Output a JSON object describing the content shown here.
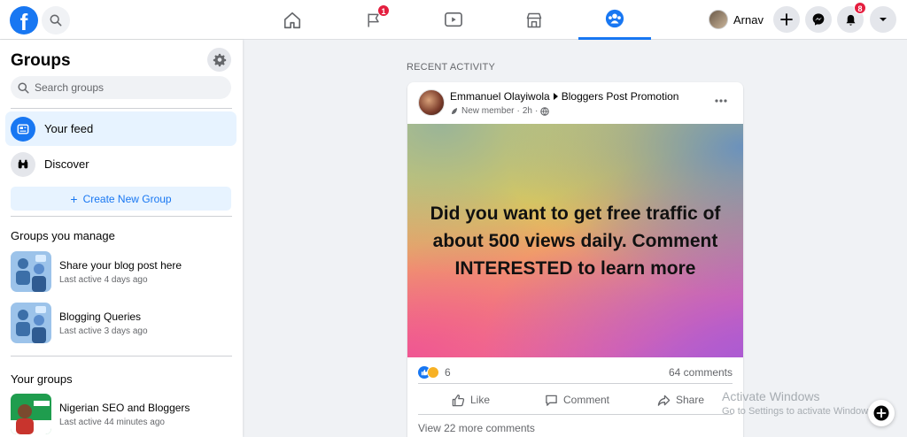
{
  "topbar": {
    "logo_letter": "f",
    "notifications_badge": "1",
    "alerts_badge": "8",
    "profile_name": "Arnav",
    "accent_color": "#1877f2"
  },
  "sidebar": {
    "title": "Groups",
    "search_placeholder": "Search groups",
    "items": [
      {
        "label": "Your feed",
        "icon": "feed-icon",
        "active": true
      },
      {
        "label": "Discover",
        "icon": "binoculars-icon",
        "active": false
      }
    ],
    "create_label": "Create New Group",
    "manage_title": "Groups you manage",
    "managed_groups": [
      {
        "name": "Share your blog post here",
        "last_active": "Last active 4 days ago"
      },
      {
        "name": "Blogging Queries",
        "last_active": "Last active 3 days ago"
      }
    ],
    "your_groups_title": "Your groups",
    "your_groups": [
      {
        "name": "Nigerian SEO and Bloggers",
        "last_active": "Last active 44 minutes ago"
      }
    ]
  },
  "feed": {
    "section_label": "RECENT ACTIVITY",
    "post": {
      "author": "Emmanuel Olayiwola",
      "group": "Bloggers Post Promotion",
      "role": "New member",
      "time": "2h",
      "text": "Did you want to get free traffic of about 500 views daily. Comment INTERESTED to learn more",
      "reaction_count": "6",
      "comments_count": "64 comments",
      "actions": {
        "like": "Like",
        "comment": "Comment",
        "share": "Share"
      },
      "view_more": "View 22 more comments"
    }
  },
  "watermark": {
    "title": "Activate Windows",
    "subtitle": "Go to Settings to activate Windows."
  }
}
